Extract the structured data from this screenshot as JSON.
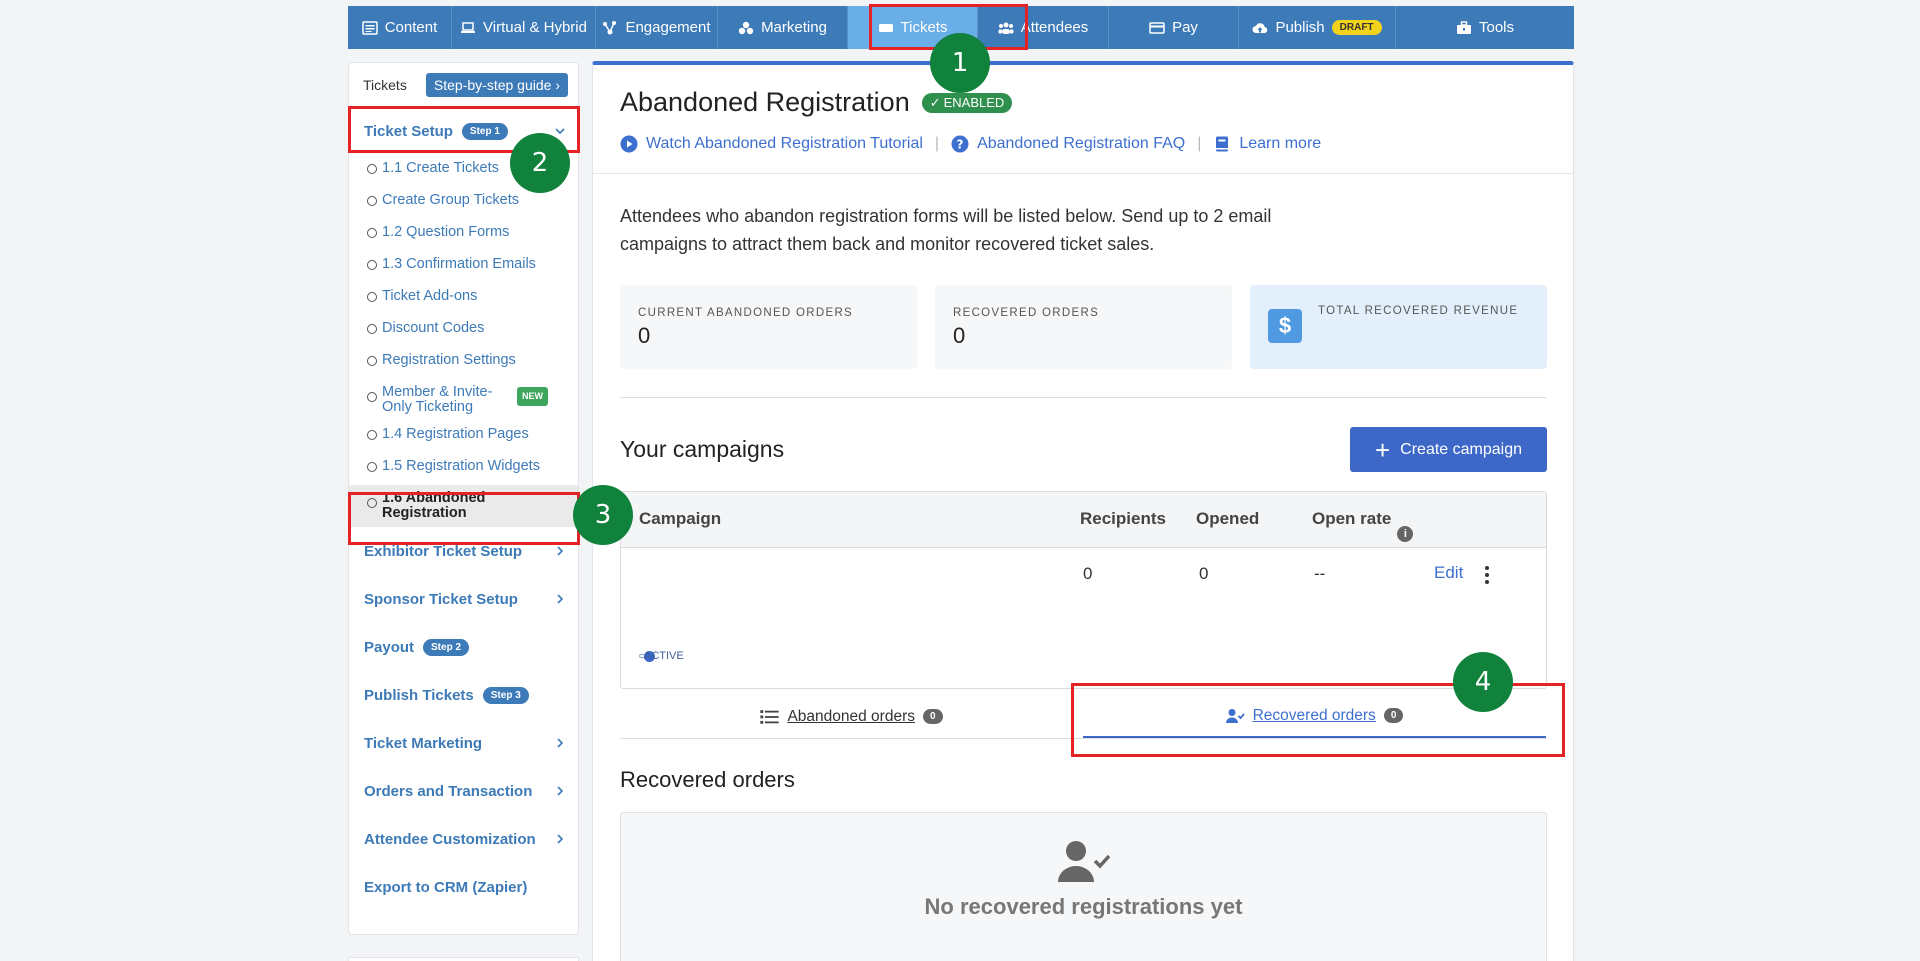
{
  "topnav": {
    "items": [
      {
        "label": "Content",
        "icon": "content-icon"
      },
      {
        "label": "Virtual & Hybrid",
        "icon": "laptop-icon"
      },
      {
        "label": "Engagement",
        "icon": "engagement-icon"
      },
      {
        "label": "Marketing",
        "icon": "marketing-icon"
      },
      {
        "label": "Tickets",
        "icon": "ticket-icon",
        "active": true
      },
      {
        "label": "Attendees",
        "icon": "attendees-icon"
      },
      {
        "label": "Pay",
        "icon": "card-icon"
      },
      {
        "label": "Publish",
        "icon": "cloud-upload-icon",
        "badge": "DRAFT"
      },
      {
        "label": "Tools",
        "icon": "toolbox-icon"
      }
    ]
  },
  "sidebar": {
    "title": "Tickets",
    "guide_button": "Step-by-step guide",
    "ticket_setup": {
      "label": "Ticket Setup",
      "step": "Step 1"
    },
    "sub_items": [
      "1.1 Create Tickets",
      "Create Group Tickets",
      "1.2 Question Forms",
      "1.3 Confirmation Emails",
      "Ticket Add-ons",
      "Discount Codes",
      "Registration Settings",
      "Member & Invite-Only Ticketing",
      "1.4 Registration Pages",
      "1.5 Registration Widgets",
      "1.6 Abandoned Registration"
    ],
    "new_badge": "NEW",
    "sections": [
      {
        "label": "Exhibitor Ticket Setup",
        "chevron": true
      },
      {
        "label": "Sponsor Ticket Setup",
        "chevron": true
      },
      {
        "label": "Payout",
        "step": "Step 2"
      },
      {
        "label": "Publish Tickets",
        "step": "Step 3"
      },
      {
        "label": "Ticket Marketing",
        "chevron": true
      },
      {
        "label": "Orders and Transaction",
        "chevron": true
      },
      {
        "label": "Attendee Customization",
        "chevron": true
      },
      {
        "label": "Export to CRM (Zapier)"
      }
    ]
  },
  "main": {
    "title": "Abandoned Registration",
    "status": "ENABLED",
    "links": {
      "tutorial": "Watch Abandoned Registration Tutorial",
      "faq": "Abandoned Registration FAQ",
      "learn": "Learn more"
    },
    "description": "Attendees who abandon registration forms will be listed below. Send up to 2 email campaigns to attract them back and monitor recovered ticket sales.",
    "stats": {
      "abandoned_label": "CURRENT ABANDONED ORDERS",
      "abandoned_value": "0",
      "recovered_label": "RECOVERED ORDERS",
      "recovered_value": "0",
      "revenue_label": "TOTAL RECOVERED REVENUE",
      "revenue_icon": "$"
    },
    "campaigns": {
      "title": "Your campaigns",
      "create_button": "Create campaign",
      "columns": [
        "Campaign",
        "Recipients",
        "Opened",
        "Open rate"
      ],
      "rows": [
        {
          "recipients": "0",
          "opened": "0",
          "open_rate": "--",
          "edit": "Edit",
          "status": "ACTIVE"
        }
      ]
    },
    "tabs": [
      {
        "label": "Abandoned orders",
        "count": "0"
      },
      {
        "label": "Recovered orders",
        "count": "0",
        "selected": true
      }
    ],
    "recovered": {
      "title": "Recovered orders",
      "empty_message": "No recovered registrations yet"
    }
  },
  "annotations": [
    "1",
    "2",
    "3",
    "4"
  ],
  "colors": {
    "nav": "#3d7ab8",
    "nav_active": "#6aaee8",
    "primary": "#3d68c8",
    "annotation_box": "#e52225",
    "annotation_marker": "#11823b"
  }
}
